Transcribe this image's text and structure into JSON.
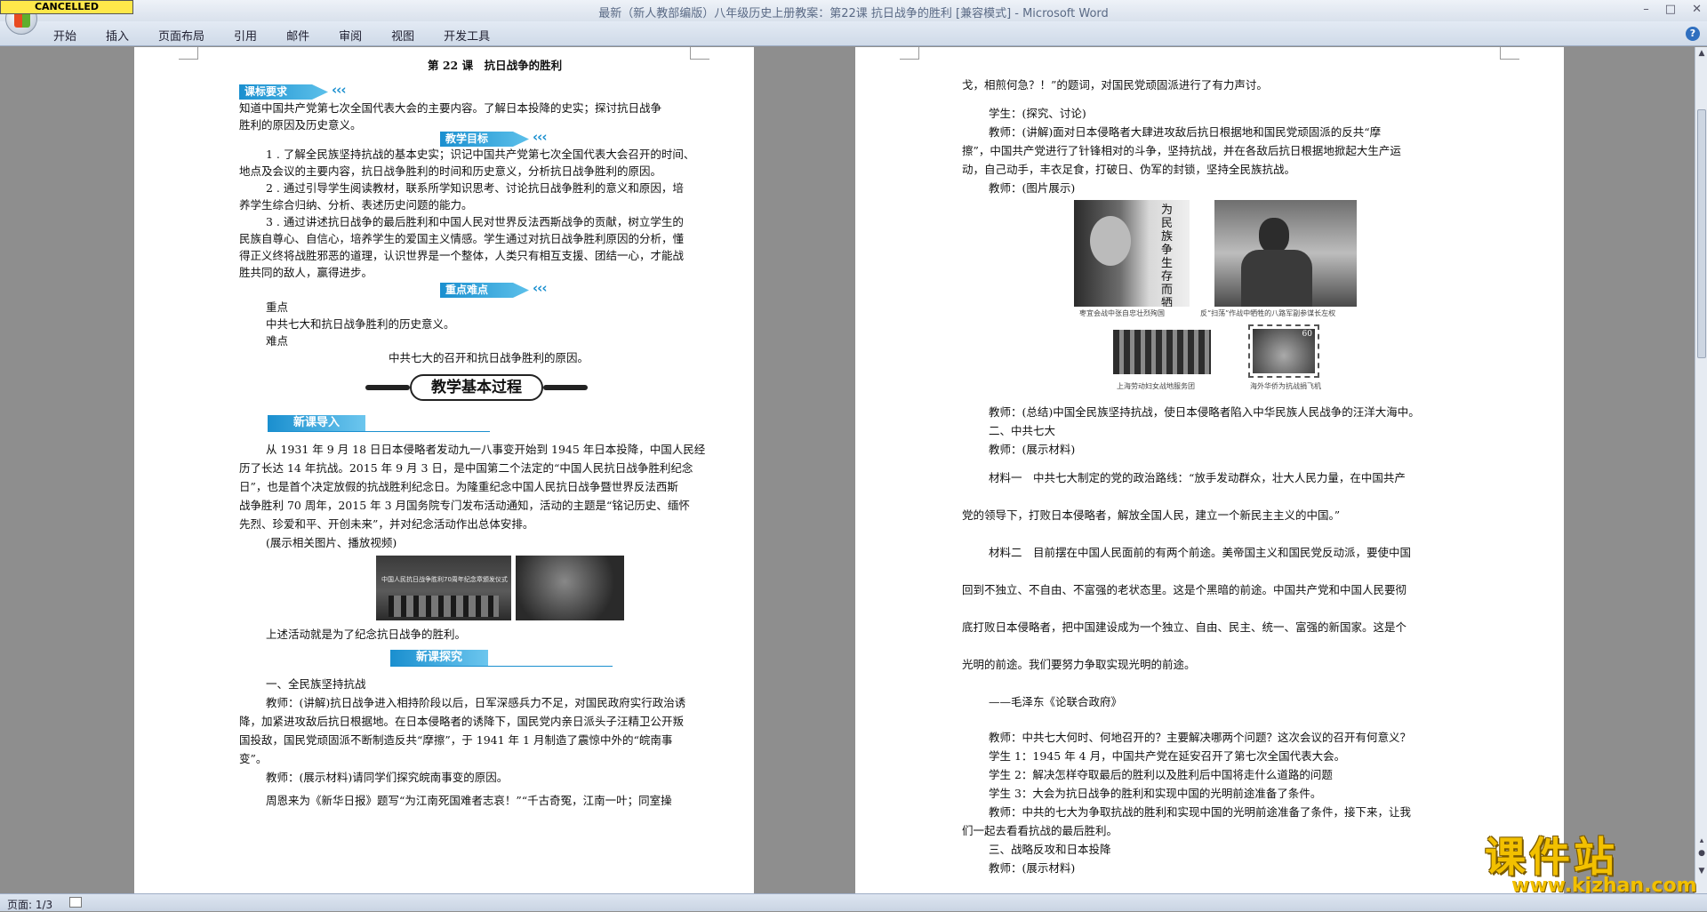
{
  "window": {
    "title": "最新（新人教部编版）八年级历史上册教案：第22课 抗日战争的胜利 [兼容模式] - Microsoft Word",
    "cancelled_badge": "CANCELLED",
    "controls": [
      "–",
      "□",
      "✕"
    ]
  },
  "ribbon": {
    "tabs": [
      "开始",
      "插入",
      "页面布局",
      "引用",
      "邮件",
      "审阅",
      "视图",
      "开发工具"
    ],
    "help": "?"
  },
  "status": {
    "page": "页面: 1/3"
  },
  "page1": {
    "lesson_title": "第 22 课　抗日战争的胜利",
    "banner_standard": "课标要求",
    "standard_text": [
      "知道中国共产党第七次全国代表大会的主要内容。了解日本投降的史实；探讨抗日战争",
      "胜利的原因及历史意义。"
    ],
    "banner_goals": "教学目标",
    "goals": [
      "1 . 了解全民族坚持抗战的基本史实；识记中国共产党第七次全国代表大会召开的时间、",
      "地点及会议的主要内容，抗日战争胜利的时间和历史意义，分析抗日战争胜利的原因。",
      "2 . 通过引导学生阅读教材，联系所学知识思考、讨论抗日战争胜利的意义和原因，培",
      "养学生综合归纳、分析、表述历史问题的能力。",
      "3 . 通过讲述抗日战争的最后胜利和中国人民对世界反法西斯战争的贡献，树立学生的",
      "民族自尊心、自信心，培养学生的爱国主义情感。学生通过对抗日战争胜利原因的分析，懂",
      "得正义终将战胜邪恶的道理，认识世界是一个整体，人类只有相互支援、团结一心，才能战",
      "胜共同的敌人，赢得进步。"
    ],
    "banner_key": "重点难点",
    "key_label": "重点",
    "key_text": "中共七大和抗日战争胜利的历史意义。",
    "difficulty_label": "难点",
    "difficulty_text": "中共七大的召开和抗日战争胜利的原因。",
    "process_title": "教学基本过程",
    "intro_title": "新课导入",
    "intro_text": [
      "从 1931 年 9 月 18 日日本侵略者发动九一八事变开始到 1945 年日本投降，中国人民经",
      "历了长达 14 年抗战。2015 年 9 月 3 日，是中国第二个法定的“中国人民抗日战争胜利纪念",
      "日”，也是首个决定放假的抗战胜利纪念日。为隆重纪念中国人民抗日战争暨世界反法西斯",
      "战争胜利 70 周年，2015 年 3 月国务院专门发布活动通知，活动的主题是“铭记历史、缅怀",
      "先烈、珍爱和平、开创未来”，并对纪念活动作出总体安排。"
    ],
    "show_media": "(展示相关图片、播放视频)",
    "photo1_text": "中国人民抗日战争胜利70周年纪念章颁发仪式",
    "conclusion": "上述活动就是为了纪念抗日战争的胜利。",
    "explore_title": "新课探究",
    "explore_lines": [
      "一、全民族坚持抗战",
      "教师：(讲解)抗日战争进入相持阶段以后，日军深感兵力不足，对国民政府实行政治诱",
      "降，加紧进攻敌后抗日根据地。在日本侵略者的诱降下，国民党内亲日派头子汪精卫公开叛",
      "国投敌，国民党顽固派不断制造反共“摩擦”，于 1941 年 1 月制造了震惊中外的“皖南事",
      "变”。",
      "教师：(展示材料)请同学们探究皖南事变的原因。",
      "周恩来为《新华日报》题写“为江南死国难者志哀！”“千古奇冤，江南一叶；同室操"
    ]
  },
  "page2": {
    "lines_top": [
      "戈，相煎何急？！”的题词，对国民党顽固派进行了有力声讨。",
      "学生：(探究、讨论)",
      "教师：(讲解)面对日本侵略者大肆进攻敌后抗日根据地和国民党顽固派的反共“摩",
      "擦”，中国共产党进行了针锋相对的斗争，坚持抗战，并在各敌后抗日根据地掀起大生产运",
      "动，自己动手，丰衣足食，打破日、伪军的封锁，坚持全民族抗战。",
      "教师：(图片展示)"
    ],
    "captions": [
      "枣宜会战中张自忠壮烈殉国",
      "反“扫荡”作战中牺牲的八路军副参谋长左权",
      "上海劳动妇女战地服务团",
      "海外华侨为抗战捐飞机"
    ],
    "calligraphy": "为民族争生存而牺牲",
    "stamp_value": "60",
    "lines_mid": [
      "教师：(总结)中国全民族坚持抗战，使日本侵略者陷入中华民族人民战争的汪洋大海中。",
      "二、中共七大",
      "教师：(展示材料)"
    ],
    "material_lines": [
      "材料一　中共七大制定的党的政治路线：“放手发动群众，壮大人民力量，在中国共产",
      "党的领导下，打败日本侵略者，解放全国人民，建立一个新民主主义的中国。”",
      "材料二　目前摆在中国人民面前的有两个前途。美帝国主义和国民党反动派，要使中国",
      "回到不独立、不自由、不富强的老状态里。这是个黑暗的前途。中国共产党和中国人民要彻",
      "底打败日本侵略者，把中国建设成为一个独立、自由、民主、统一、富强的新国家。这是个",
      "光明的前途。我们要努力争取实现光明的前途。",
      "——毛泽东《论联合政府》"
    ],
    "lines_bottom": [
      "教师：中共七大何时、何地召开的？主要解决哪两个问题？这次会议的召开有何意义？",
      "学生 1：1945 年 4 月，中国共产党在延安召开了第七次全国代表大会。",
      "学生 2：解决怎样夺取最后的胜利以及胜利后中国将走什么道路的问题",
      "学生 3：大会为抗日战争的胜利和实现中国的光明前途准备了条件。",
      "教师：中共的七大为争取抗战的胜利和实现中国的光明前途准备了条件，接下来，让我",
      "们一起去看看抗战的最后胜利。",
      "三、战略反攻和日本投降",
      "教师：(展示材料)"
    ]
  },
  "watermark": {
    "text": "课件站",
    "url": "www.kjzhan.com"
  }
}
